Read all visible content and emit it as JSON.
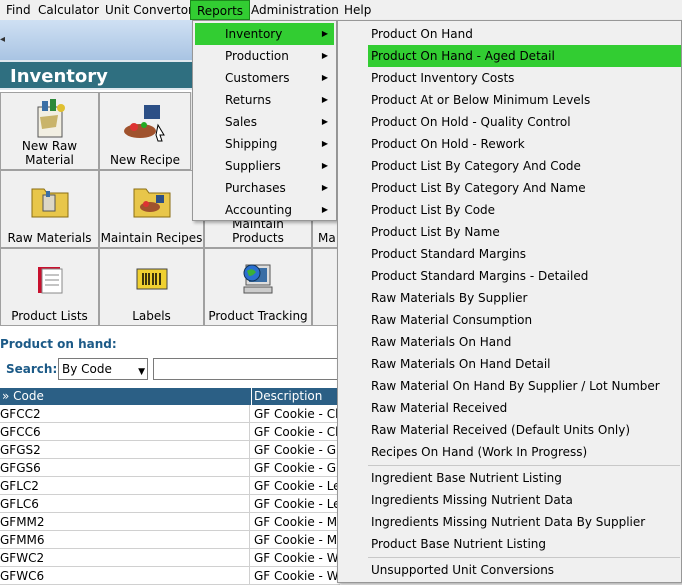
{
  "menubar": {
    "items": [
      {
        "label": "Find"
      },
      {
        "label": "Calculator"
      },
      {
        "label": "Unit Convertor"
      },
      {
        "label": "Reports"
      },
      {
        "label": "Administration"
      },
      {
        "label": "Help"
      }
    ]
  },
  "page": {
    "title": "Inventory"
  },
  "tiles": [
    {
      "label": "New Raw\nMaterial",
      "icon": "new-raw-material-icon"
    },
    {
      "label": "New Recipe",
      "icon": "new-recipe-icon"
    },
    {
      "label": "Raw Materials",
      "icon": "raw-materials-folder-icon"
    },
    {
      "label": "Maintain Recipes",
      "icon": "maintain-recipes-folder-icon"
    },
    {
      "label": "Maintain Products",
      "icon": "maintain-products-icon"
    },
    {
      "label": "Ma",
      "icon": "partial-tile-icon"
    },
    {
      "label": "Product Lists",
      "icon": "product-lists-icon"
    },
    {
      "label": "Labels",
      "icon": "labels-icon"
    },
    {
      "label": "Product Tracking",
      "icon": "product-tracking-icon"
    }
  ],
  "search": {
    "heading": "Product on hand:",
    "label": "Search:",
    "mode": "By Code",
    "value": ""
  },
  "grid": {
    "headers": [
      "» Code",
      "Description"
    ],
    "rows": [
      {
        "code": "GFCC2",
        "desc": "GF Cookie - Ch"
      },
      {
        "code": "GFCC6",
        "desc": "GF Cookie - Ch"
      },
      {
        "code": "GFGS2",
        "desc": "GF Cookie - Gi"
      },
      {
        "code": "GFGS6",
        "desc": "GF Cookie - Gi"
      },
      {
        "code": "GFLC2",
        "desc": "GF Cookie - Le"
      },
      {
        "code": "GFLC6",
        "desc": "GF Cookie - Le"
      },
      {
        "code": "GFMM2",
        "desc": "GF Cookie - M&"
      },
      {
        "code": "GFMM6",
        "desc": "GF Cookie - M&"
      },
      {
        "code": "GFWC2",
        "desc": "GF Cookie - Wh"
      },
      {
        "code": "GFWC6",
        "desc": "GF Cookie - Wh"
      }
    ]
  },
  "reports_menu": {
    "items": [
      {
        "label": "Inventory"
      },
      {
        "label": "Production"
      },
      {
        "label": "Customers"
      },
      {
        "label": "Returns"
      },
      {
        "label": "Sales"
      },
      {
        "label": "Shipping"
      },
      {
        "label": "Suppliers"
      },
      {
        "label": "Purchases"
      },
      {
        "label": "Accounting"
      }
    ]
  },
  "inventory_menu": {
    "items": [
      {
        "label": "Product On Hand"
      },
      {
        "label": "Product On Hand - Aged Detail"
      },
      {
        "label": "Product Inventory Costs"
      },
      {
        "label": "Product At or Below Minimum Levels"
      },
      {
        "label": "Product On Hold - Quality Control"
      },
      {
        "label": "Product On Hold - Rework"
      },
      {
        "label": "Product List By Category And Code"
      },
      {
        "label": "Product List By Category And Name"
      },
      {
        "label": "Product List By Code"
      },
      {
        "label": "Product List By Name"
      },
      {
        "label": "Product Standard Margins"
      },
      {
        "label": "Product Standard Margins - Detailed"
      },
      {
        "label": "Raw Materials By Supplier"
      },
      {
        "label": "Raw Material Consumption"
      },
      {
        "label": "Raw Materials On Hand"
      },
      {
        "label": "Raw Materials On Hand Detail"
      },
      {
        "label": "Raw Material On Hand By Supplier / Lot Number"
      },
      {
        "label": "Raw Material Received"
      },
      {
        "label": "Raw Material Received (Default Units Only)"
      },
      {
        "label": "Recipes On Hand (Work In Progress)"
      },
      {
        "label": "Ingredient Base Nutrient Listing"
      },
      {
        "label": "Ingredients Missing Nutrient Data"
      },
      {
        "label": "Ingredients Missing Nutrient Data By Supplier"
      },
      {
        "label": "Product Base Nutrient Listing"
      },
      {
        "label": "Unsupported Unit Conversions"
      }
    ]
  },
  "colors": {
    "highlight": "#32cd32",
    "title_bar": "#2f6f80",
    "grid_header": "#2b5f85"
  }
}
